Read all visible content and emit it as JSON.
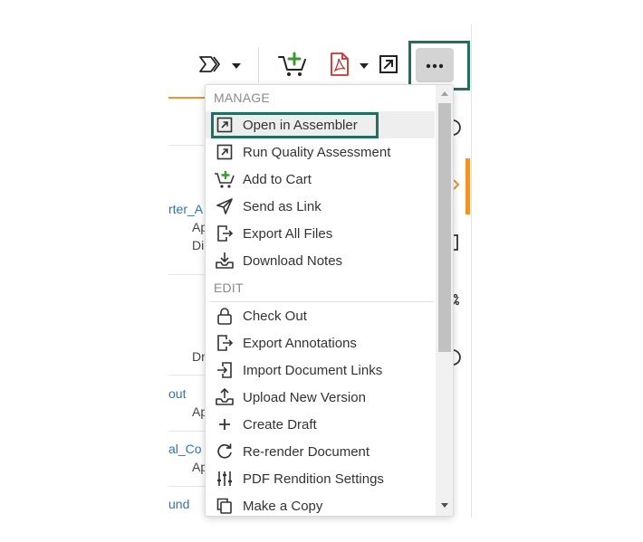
{
  "toolbar": {
    "icons": [
      "workflow-icon",
      "add-to-cart-icon",
      "pdf-icon",
      "open-external-icon",
      "more-options-icon"
    ],
    "more_label": "•••",
    "colors": {
      "cart_plus": "#3a9a2f",
      "pdf": "#c9302c",
      "highlight_border": "#1f6f63",
      "accent_orange": "#f0932b",
      "link": "#2f75b5"
    }
  },
  "background": {
    "links": [
      "rter_A",
      "out",
      "al_Co",
      "und"
    ],
    "texts": [
      "Ap",
      "Di",
      "Dr",
      "Ap",
      "Ap"
    ]
  },
  "menu": {
    "sections": [
      {
        "header": "MANAGE",
        "items": [
          {
            "label": "Open in Assembler",
            "icon": "open-external-icon",
            "highlighted": true
          },
          {
            "label": "Run Quality Assessment",
            "icon": "open-external-icon"
          },
          {
            "label": "Add to Cart",
            "icon": "add-to-cart-icon"
          },
          {
            "label": "Send as Link",
            "icon": "send-icon"
          },
          {
            "label": "Export All Files",
            "icon": "export-file-icon"
          },
          {
            "label": "Download Notes",
            "icon": "download-tray-icon"
          }
        ]
      },
      {
        "header": "EDIT",
        "items": [
          {
            "label": "Check Out",
            "icon": "lock-icon"
          },
          {
            "label": "Export Annotations",
            "icon": "export-file-icon"
          },
          {
            "label": "Import Document Links",
            "icon": "import-file-icon"
          },
          {
            "label": "Upload New Version",
            "icon": "upload-tray-icon"
          },
          {
            "label": "Create Draft",
            "icon": "plus-icon"
          },
          {
            "label": "Re-render Document",
            "icon": "refresh-icon"
          },
          {
            "label": "PDF Rendition Settings",
            "icon": "sliders-icon"
          },
          {
            "label": "Make a Copy",
            "icon": "copy-icon"
          }
        ]
      }
    ]
  }
}
